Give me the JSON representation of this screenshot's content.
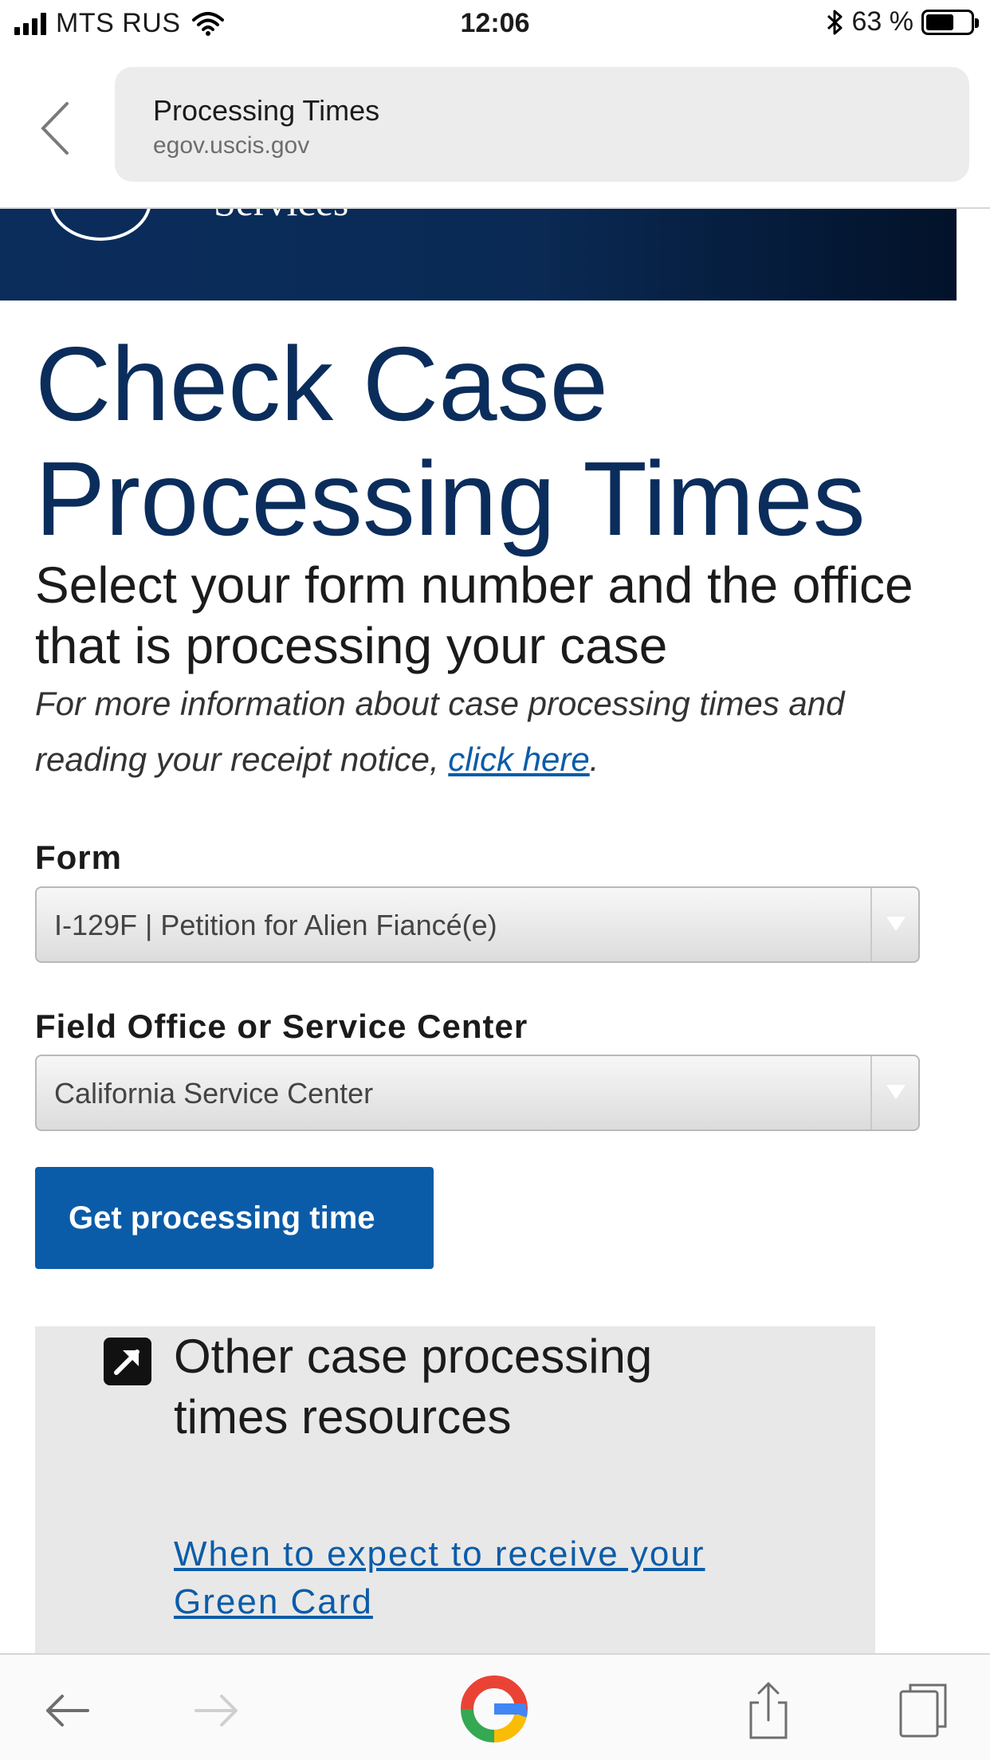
{
  "status_bar": {
    "carrier": "MTS RUS",
    "time": "12:06",
    "battery_percent_text": "63 %",
    "battery_level": 0.63,
    "icons": [
      "signal-icon",
      "wifi-icon",
      "bluetooth-icon",
      "battery-icon"
    ]
  },
  "browser": {
    "page_title": "Processing Times",
    "domain": "egov.uscis.gov",
    "icons": [
      "chevron-left-icon"
    ]
  },
  "banner": {
    "agency_fragment": "Services"
  },
  "main": {
    "title": "Check Case Processing Times",
    "subtitle": "Select your form number and the office that is processing your case",
    "info_prefix": "For more information about case processing times and reading your receipt notice, ",
    "info_link": "click here",
    "info_suffix": "."
  },
  "form": {
    "form_label": "Form",
    "form_value": "I-129F | Petition for Alien Fiancé(e)",
    "office_label": "Field Office or Service Center",
    "office_value": "California Service Center",
    "submit_label": "Get processing time"
  },
  "resources": {
    "heading": "Other case processing times resources",
    "link": "When to expect to receive your Green Card",
    "icons": [
      "external-link-icon"
    ]
  },
  "toolbar": {
    "icons": [
      "back-arrow-icon",
      "forward-arrow-icon",
      "google-icon",
      "share-icon",
      "tabs-icon"
    ]
  },
  "colors": {
    "brand_navy": "#0b2d5c",
    "link_blue": "#0b5ca8",
    "button_blue": "#0b5ca8"
  }
}
